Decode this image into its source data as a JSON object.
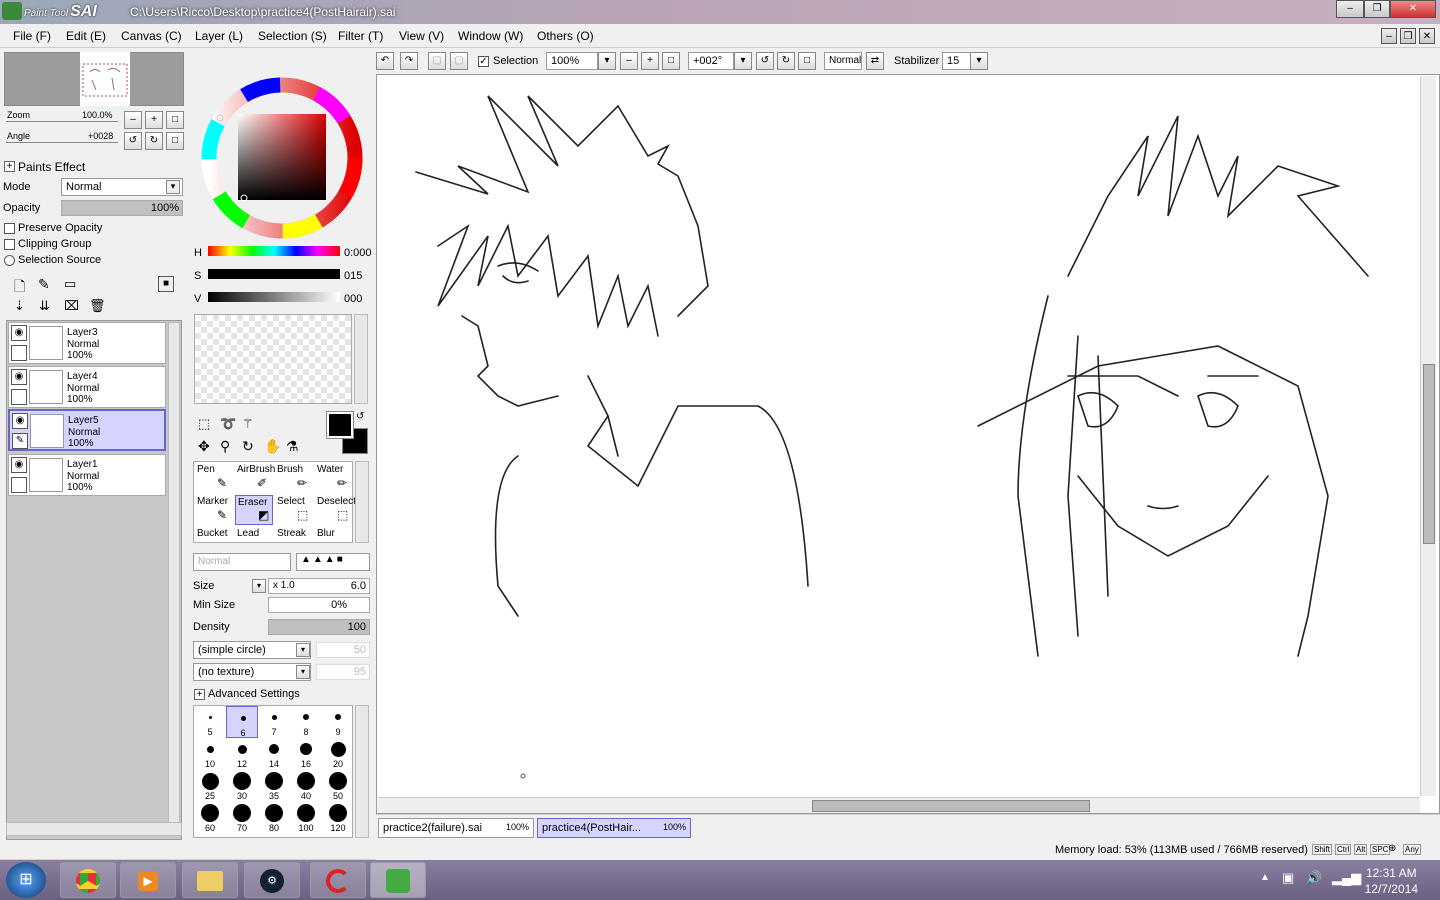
{
  "titlebar": {
    "app_label": "Paint Tool",
    "app_name": "SAI",
    "path": "C:\\Users\\Ricco\\Desktop\\practice4(PostHairair).sai"
  },
  "menu": [
    "File (F)",
    "Edit (E)",
    "Canvas (C)",
    "Layer (L)",
    "Selection (S)",
    "Filter (T)",
    "View (V)",
    "Window (W)",
    "Others (O)"
  ],
  "toolbar": {
    "selection_label": "Selection",
    "zoom": "100%",
    "angle": "+002°",
    "blend": "Normal",
    "stabilizer_label": "Stabilizer",
    "stabilizer_value": "15"
  },
  "navigator": {
    "zoom_label": "Zoom",
    "zoom_value": "100.0%",
    "angle_label": "Angle",
    "angle_value": "+0028"
  },
  "paints_effect": {
    "header": "Paints Effect",
    "mode_label": "Mode",
    "mode_value": "Normal",
    "opacity_label": "Opacity",
    "opacity_value": "100%",
    "opacity_fraction": 1.0
  },
  "layer_options": {
    "preserve": "Preserve Opacity",
    "clipping": "Clipping Group",
    "selection_source": "Selection Source"
  },
  "layers": [
    {
      "name": "Layer3",
      "mode": "Normal",
      "opacity": "100%"
    },
    {
      "name": "Layer4",
      "mode": "Normal",
      "opacity": "100%"
    },
    {
      "name": "Layer5",
      "mode": "Normal",
      "opacity": "100%"
    },
    {
      "name": "Layer1",
      "mode": "Normal",
      "opacity": "100%"
    }
  ],
  "hsv": {
    "h_label": "H",
    "h_value": "0:000",
    "s_label": "S",
    "s_value": "015",
    "v_label": "V",
    "v_value": "000"
  },
  "tools": [
    {
      "name": "Pen"
    },
    {
      "name": "AirBrush"
    },
    {
      "name": "Brush"
    },
    {
      "name": "Water"
    },
    {
      "name": "Marker"
    },
    {
      "name": "Eraser"
    },
    {
      "name": "Select"
    },
    {
      "name": "Deselect"
    },
    {
      "name": "Bucket"
    },
    {
      "name": "Lead"
    },
    {
      "name": "Streak"
    },
    {
      "name": "Blur"
    }
  ],
  "brush": {
    "blend": "Normal",
    "size_label": "Size",
    "size_mult": "x 1.0",
    "size_value": "6.0",
    "minsize_label": "Min Size",
    "minsize_value": "0%",
    "density_label": "Density",
    "density_value": "100",
    "shape": "(simple circle)",
    "shape_value": "50",
    "texture": "(no texture)",
    "texture_value": "95",
    "advanced": "Advanced Settings"
  },
  "brush_sizes": [
    "5",
    "6",
    "7",
    "8",
    "9",
    "10",
    "12",
    "14",
    "16",
    "20",
    "25",
    "30",
    "35",
    "40",
    "50",
    "60",
    "70",
    "80",
    "100",
    "120"
  ],
  "tabs": [
    {
      "name": "practice2(failure).sai",
      "zoom": "100%"
    },
    {
      "name": "practice4(PostHair...",
      "zoom": "100%"
    }
  ],
  "status": {
    "memory": "Memory load: 53% (113MB used / 766MB reserved)",
    "keys": [
      "Shift",
      "Ctrl",
      "Alt",
      "SPC",
      "Any"
    ]
  },
  "clock": {
    "time": "12:31 AM",
    "date": "12/7/2014"
  },
  "colors": {
    "accent": "#6666cc",
    "selected_bg": "#d4d4ff",
    "primary_color": "#000000"
  }
}
